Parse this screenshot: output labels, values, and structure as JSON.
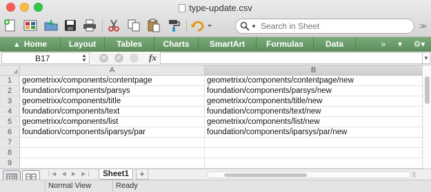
{
  "window": {
    "title": "type-update.csv"
  },
  "toolbar": {
    "search_placeholder": "Search in Sheet",
    "buttons": [
      "new-icon",
      "templates-icon",
      "open-icon",
      "save-icon",
      "print-icon",
      "cut-icon",
      "copy-icon",
      "paste-icon",
      "format-painter-icon",
      "undo-icon"
    ]
  },
  "ribbon": {
    "tabs": [
      "Home",
      "Layout",
      "Tables",
      "Charts",
      "SmartArt",
      "Formulas",
      "Data"
    ],
    "more": "»"
  },
  "formula_bar": {
    "name_box": "B17",
    "fx": "fx",
    "value": ""
  },
  "grid": {
    "columns": [
      "A",
      "B"
    ],
    "rows": [
      {
        "num": "1",
        "a": "geometrixx/components/contentpage",
        "b": "geometrixx/components/contentpage/new"
      },
      {
        "num": "2",
        "a": "foundation/components/parsys",
        "b": "foundation/components/parsys/new"
      },
      {
        "num": "3",
        "a": "geometrixx/components/title",
        "b": "geometrixx/components/title/new"
      },
      {
        "num": "4",
        "a": "foundation/components/text",
        "b": "foundation/components/text/new"
      },
      {
        "num": "5",
        "a": "geometrixx/components/list",
        "b": "geometrixx/components/list/new"
      },
      {
        "num": "6",
        "a": "foundation/components/iparsys/par",
        "b": "foundation/components/iparsys/par/new"
      },
      {
        "num": "7",
        "a": "",
        "b": ""
      },
      {
        "num": "8",
        "a": "",
        "b": ""
      },
      {
        "num": "9",
        "a": "",
        "b": ""
      }
    ]
  },
  "sheets": {
    "active": "Sheet1",
    "add": "+"
  },
  "status": {
    "view": "Normal View",
    "state": "Ready"
  },
  "colors": {
    "ribbon": "#6a9a6a",
    "traffic_close": "#fc605c",
    "traffic_min": "#fdbc40",
    "traffic_max": "#34c84a"
  }
}
